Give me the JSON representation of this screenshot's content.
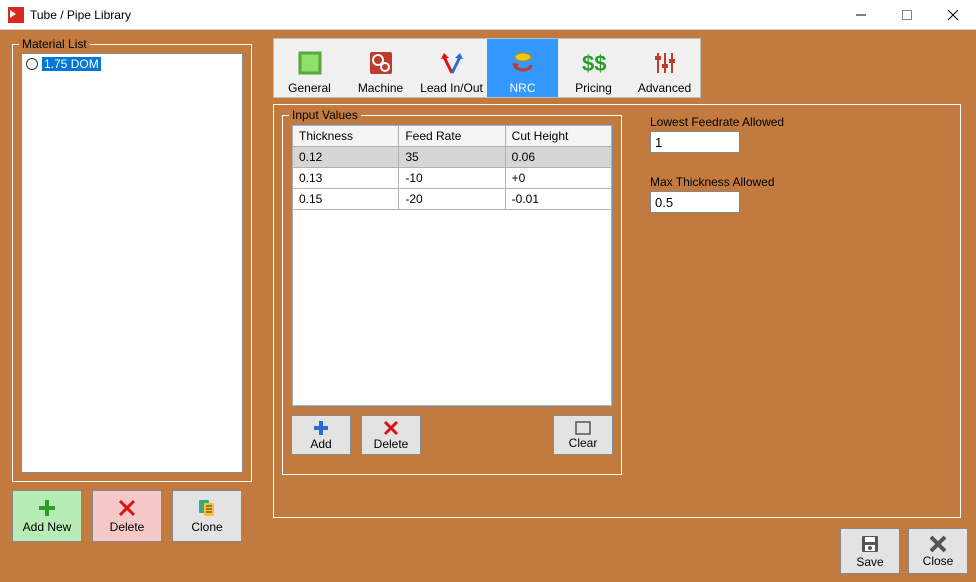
{
  "window": {
    "title": "Tube / Pipe Library"
  },
  "material_list": {
    "legend": "Material List",
    "items": [
      {
        "label": "1.75 DOM",
        "selected": true
      }
    ],
    "buttons": {
      "add_new": "Add New",
      "delete": "Delete",
      "clone": "Clone"
    }
  },
  "tabs": {
    "general": "General",
    "machine": "Machine",
    "leadinout": "Lead In/Out",
    "nrc": "NRC",
    "pricing": "Pricing",
    "advanced": "Advanced",
    "selected": "nrc"
  },
  "input_values": {
    "legend": "Input Values",
    "columns": [
      "Thickness",
      "Feed Rate",
      "Cut Height"
    ],
    "rows": [
      {
        "thickness": "0.12",
        "feed_rate": "35",
        "cut_height": "0.06",
        "selected": true
      },
      {
        "thickness": "0.13",
        "feed_rate": "-10",
        "cut_height": "+0",
        "selected": false
      },
      {
        "thickness": "0.15",
        "feed_rate": "-20",
        "cut_height": "-0.01",
        "selected": false
      }
    ],
    "buttons": {
      "add": "Add",
      "delete": "Delete",
      "clear": "Clear"
    }
  },
  "params": {
    "lowest_feedrate": {
      "label": "Lowest Feedrate Allowed",
      "value": "1"
    },
    "max_thickness": {
      "label": "Max Thickness Allowed",
      "value": "0.5"
    }
  },
  "footer": {
    "save": "Save",
    "close": "Close"
  }
}
